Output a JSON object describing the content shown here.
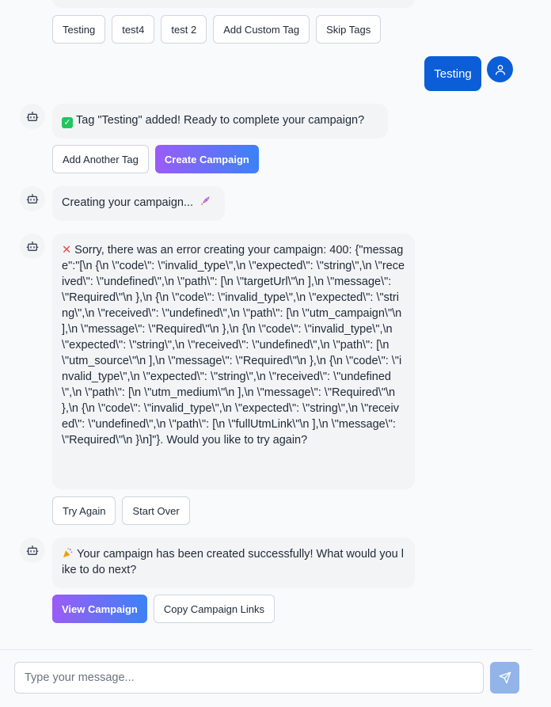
{
  "tag_options": [
    "Testing",
    "test4",
    "test 2",
    "Add Custom Tag",
    "Skip Tags"
  ],
  "user_message": "Testing",
  "messages": {
    "tag_added": {
      "text": "Tag \"Testing\" added! Ready to complete your campaign?",
      "icon": "check-mark-icon"
    },
    "tag_added_actions": {
      "add_another": "Add Another Tag",
      "create": "Create Campaign"
    },
    "creating": {
      "text": "Creating your campaign...",
      "icon": "rocket-icon"
    },
    "error": {
      "icon": "cross-mark-icon",
      "text": "Sorry, there was an error creating your campaign: 400: {\"message\":\"[\\n {\\n \\\"code\\\": \\\"invalid_type\\\",\\n \\\"expected\\\": \\\"string\\\",\\n \\\"received\\\": \\\"undefined\\\",\\n \\\"path\\\": [\\n \\\"targetUrl\\\"\\n ],\\n \\\"message\\\": \\\"Required\\\"\\n },\\n {\\n \\\"code\\\": \\\"invalid_type\\\",\\n \\\"expected\\\": \\\"string\\\",\\n \\\"received\\\": \\\"undefined\\\",\\n \\\"path\\\": [\\n \\\"utm_campaign\\\"\\n ],\\n \\\"message\\\": \\\"Required\\\"\\n },\\n {\\n \\\"code\\\": \\\"invalid_type\\\",\\n \\\"expected\\\": \\\"string\\\",\\n \\\"received\\\": \\\"undefined\\\",\\n \\\"path\\\": [\\n \\\"utm_source\\\"\\n ],\\n \\\"message\\\": \\\"Required\\\"\\n },\\n {\\n \\\"code\\\": \\\"invalid_type\\\",\\n \\\"expected\\\": \\\"string\\\",\\n \\\"received\\\": \\\"undefined\\\",\\n \\\"path\\\": [\\n \\\"utm_medium\\\"\\n ],\\n \\\"message\\\": \\\"Required\\\"\\n },\\n {\\n \\\"code\\\": \\\"invalid_type\\\",\\n \\\"expected\\\": \\\"string\\\",\\n \\\"received\\\": \\\"undefined\\\",\\n \\\"path\\\": [\\n \\\"fullUtmLink\\\"\\n ],\\n \\\"message\\\": \\\"Required\\\"\\n }\\n]\"}. Would you like to try again?"
    },
    "error_actions": {
      "try_again": "Try Again",
      "start_over": "Start Over"
    },
    "success": {
      "icon": "party-popper-icon",
      "text": "Your campaign has been created successfully! What would you like to do next?"
    },
    "success_actions": {
      "view": "View Campaign",
      "copy": "Copy Campaign Links"
    }
  },
  "composer": {
    "placeholder": "Type your message...",
    "send_icon": "send-icon"
  },
  "colors": {
    "primary_blue": "#0b5ed7",
    "gradient_start": "#9b5cf6",
    "gradient_end": "#3b82f6",
    "bubble_bg": "#f3f4f6"
  }
}
